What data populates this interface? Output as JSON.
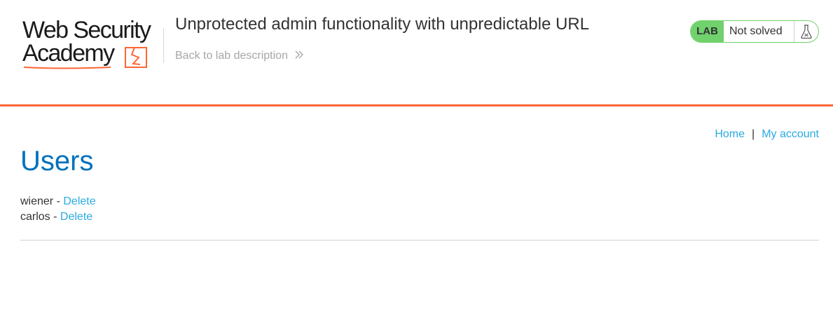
{
  "brand": {
    "logo_line1": "Web Security",
    "logo_line2": "Academy",
    "accent_color": "#ff6633"
  },
  "header": {
    "title": "Unprotected admin functionality with unpredictable URL",
    "back_link": "Back to lab description",
    "back_icon": "double-chevron-right-icon"
  },
  "lab": {
    "badge": "LAB",
    "status": "Not solved",
    "status_icon": "flask-icon",
    "badge_color": "#70d16d"
  },
  "nav": {
    "home": "Home",
    "separator": "|",
    "my_account": "My account",
    "link_color": "#29abe0"
  },
  "main": {
    "heading": "Users",
    "heading_color": "#0071bc",
    "users": [
      {
        "name": "wiener",
        "sep": " - ",
        "action": "Delete"
      },
      {
        "name": "carlos",
        "sep": " - ",
        "action": "Delete"
      }
    ]
  }
}
